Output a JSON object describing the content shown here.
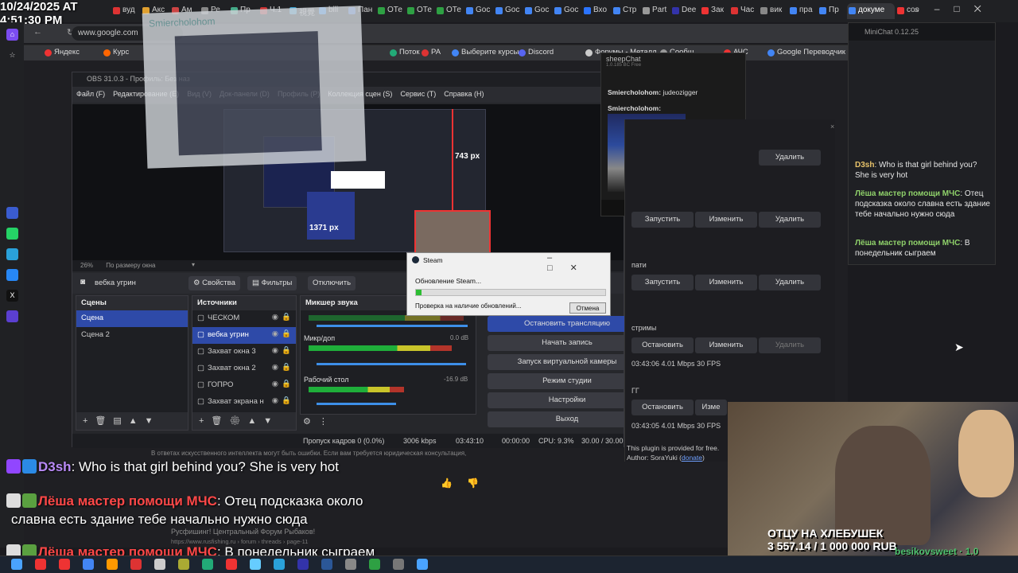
{
  "timestamp": {
    "line1": "10/24/2025 AT",
    "line2": "4:51:30 PM"
  },
  "browser": {
    "url": "www.google.com",
    "tabs": [
      "вуд",
      "Акс",
      "Ам",
      "Ре",
      "Пр",
      "Ч.1",
      "視覺",
      "bili",
      "Пан",
      "ОТе",
      "ОТе",
      "ОТе",
      "Goc",
      "Goc",
      "Goc",
      "Goc",
      "Вхо",
      "Стр",
      "Part",
      "Dee",
      "Зак",
      "Час",
      "вик",
      "пра",
      "Пр",
      "докуме",
      "cos"
    ],
    "bookmarks": [
      "Яндекс",
      "Курс",
      "Поток",
      "РА",
      "Выберите курсы",
      "Discord",
      "Форумы - Металл",
      "Сообщ",
      "АЧС",
      "Google Переводчик"
    ],
    "mask_text": "Smiercholohom"
  },
  "obs": {
    "title": "OBS 31.0.3 - Профиль: Без наз",
    "menu": [
      "Файл (F)",
      "Редактирование (E)",
      "Вид (V)",
      "Док-панели (D)",
      "Профиль (P)",
      "Коллекция сцен (S)",
      "Сервис (T)",
      "Справка (H)"
    ],
    "preview_px1": "743 px",
    "preview_px2": "1371 px",
    "zoom": "26%",
    "zoom_mode": "По размеру окна",
    "source_name": "вебка угрин",
    "props_label": "Свойства",
    "filters_label": "Фильтры",
    "disable_label": "Отключить",
    "scenes_title": "Сцены",
    "scenes": [
      "Сцена",
      "Сцена 2"
    ],
    "sources_title": "Источники",
    "sources": [
      "ЧЕСКОМ",
      "вебка угрин",
      "Захват окна 3",
      "Захват окна 2",
      "ГОПРО",
      "Захват экрана н"
    ],
    "mixer_title": "Микшер звука",
    "mixer": [
      {
        "name": "Микр/доп",
        "db": "0.0 dB"
      },
      {
        "name": "Рабочий стол",
        "db": "-16.9 dB"
      }
    ],
    "controls": [
      "Остановить трансляцию",
      "Начать запись",
      "Запуск виртуальной камеры",
      "Режим студии",
      "Настройки",
      "Выход"
    ],
    "status": {
      "dropped": "Пропуск кадров 0 (0.0%)",
      "kbps": "3006 kbps",
      "stream_time": "03:43:10",
      "rec_time": "00:00:00",
      "cpu": "CPU: 9.3%",
      "fps": "30.00 / 30.00 FPS"
    }
  },
  "sheepchat": {
    "title": "sheepChat",
    "version": "1.0.185 BC Free",
    "msg1_user": "Smiercholohom:",
    "msg1_text": "judeozigger",
    "msg2_user": "Smiercholohom:"
  },
  "steam": {
    "title": "Steam",
    "status": "Обновление Steam...",
    "check": "Проверка на наличие обновлений...",
    "cancel": "Отмена",
    "progress": 0.03
  },
  "rpanel": {
    "delete": "Удалить",
    "launch": "Запустить",
    "edit": "Изменить",
    "stop": "Остановить",
    "label_pati": "пати",
    "label_streams": "стримы",
    "label_gg": "ГГ",
    "stat1": "03:43:06   4.01 Mbps   30 FPS",
    "stat2": "03:43:05   4.01 Mbps   30 FPS",
    "edit_short": "Изме",
    "plugin_note": "This plugin is provided for free.",
    "author_label": "Author: SoraYuki (",
    "donate": "donate",
    "author_close": ")"
  },
  "minichat": {
    "title": "MiniChat 0.12.25",
    "messages": [
      {
        "user": "D3sh",
        "text": ": Who is that girl behind you? She is very hot"
      },
      {
        "user": "Лёша мастер помощи МЧС",
        "text": ": Отец подсказка около славна есть здание тебе начально нужно сюда"
      },
      {
        "user": "Лёша мастер помощи МЧС",
        "text": ": В понедельник сыграем"
      }
    ]
  },
  "overlay_chat": {
    "line1_user": "D3sh",
    "line1_text": ": Who is that girl behind you? She is very hot",
    "line2_user": "Лёша мастер помощи МЧС",
    "line2_text": ": Отец подсказка около",
    "line2b": "славна есть здание тебе начально нужно сюда",
    "line3_user": "Лёша мастер помощи МЧС",
    "line3_text": ": В понедельник сыграем"
  },
  "bg_text": {
    "ai_note": "В ответах искусственного интеллекта могут быть ошибки. Если вам требуется юридическая консультация,",
    "forum": "Русфишинг! Центральный Форум Рыбаков!",
    "forum_url": "https://www.rusfishing.ru › forum › threads › page-11"
  },
  "webcam": {
    "goal_title": "ОТЦУ НА ХЛЕБУШЕК",
    "goal_amount": "3 557.14 / 1 000 000 RUB",
    "ticker": "besikovsweet · 1.0"
  },
  "colors": {
    "accent": "#2e4aa8",
    "steam_green": "#2dbd33",
    "d3sh": "#b98af7",
    "lesha": "#ff4848"
  }
}
